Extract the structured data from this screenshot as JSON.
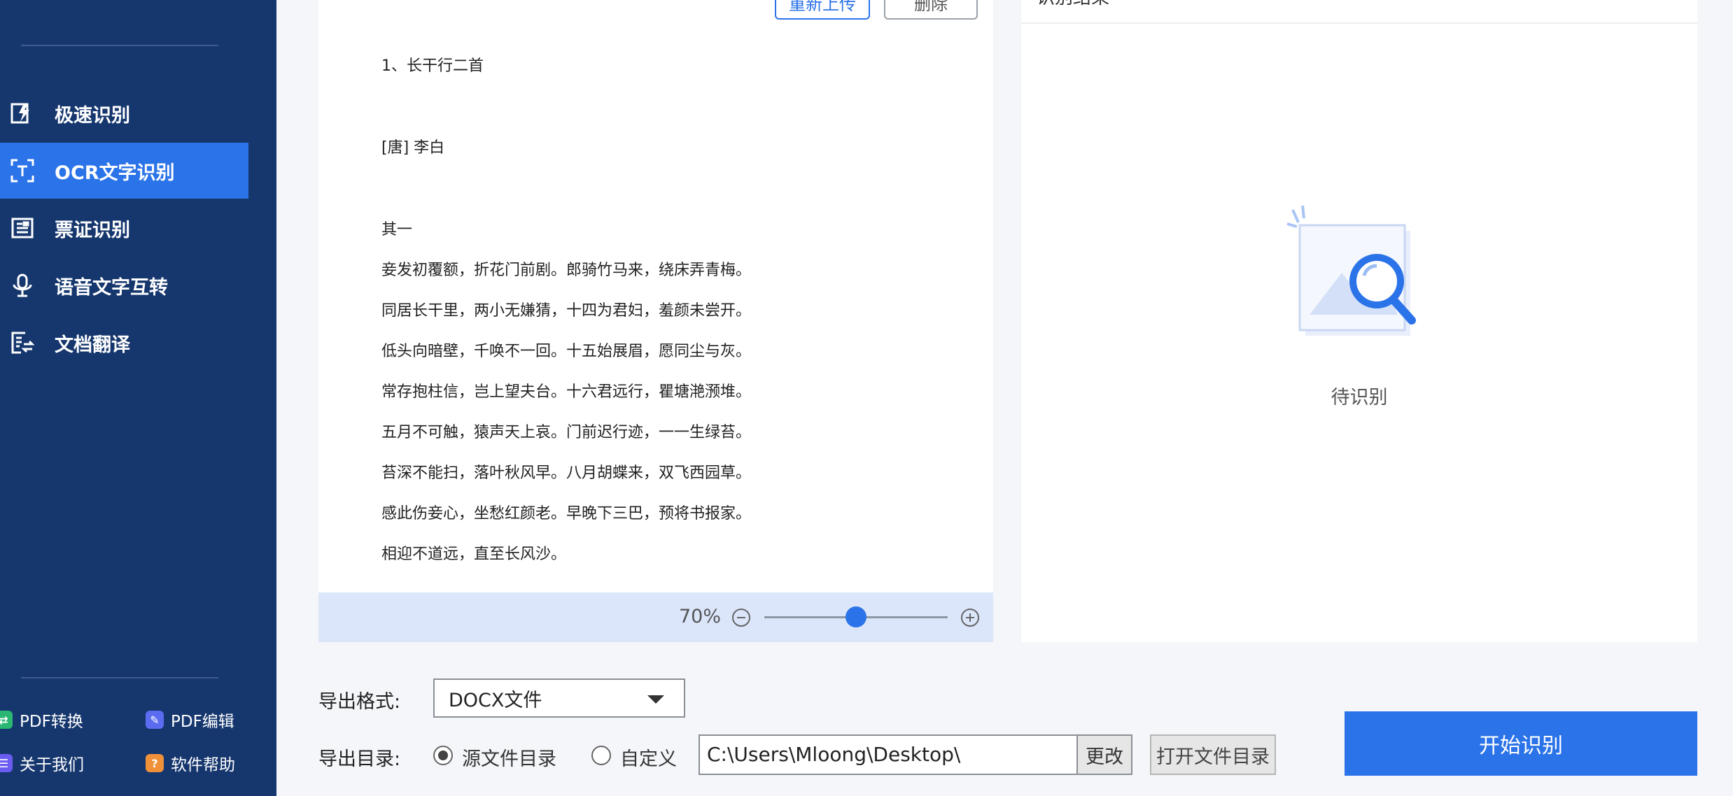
{
  "sidebar": {
    "nav": [
      {
        "label": "极速识别",
        "icon": "fast-recognition-icon"
      },
      {
        "label": "OCR文字识别",
        "icon": "ocr-icon",
        "active": true
      },
      {
        "label": "票证识别",
        "icon": "ticket-icon"
      },
      {
        "label": "语音文字互转",
        "icon": "microphone-icon"
      },
      {
        "label": "文档翻译",
        "icon": "document-translate-icon"
      }
    ],
    "footer": [
      {
        "label": "PDF转换",
        "icon": "pdf-convert-icon",
        "color": "#2bb673"
      },
      {
        "label": "PDF编辑",
        "icon": "pdf-edit-icon",
        "color": "#5b6cf0"
      },
      {
        "label": "关于我们",
        "icon": "about-icon",
        "color": "#6a5cf0"
      },
      {
        "label": "软件帮助",
        "icon": "help-icon",
        "color": "#f0913a"
      }
    ]
  },
  "preview": {
    "reupload_label": "重新上传",
    "delete_label": "删除",
    "lines": [
      "1、长干行二首",
      "[唐] 李白",
      "其一",
      "妾发初覆额，折花门前剧。郎骑竹马来，绕床弄青梅。",
      "同居长干里，两小无嫌猜，十四为君妇，羞颜未尝开。",
      "低头向暗壁，千唤不一回。十五始展眉，愿同尘与灰。",
      "常存抱柱信，岂上望夫台。十六君远行，瞿塘滟滪堆。",
      "五月不可触，猿声天上哀。门前迟行迹，一一生绿苔。",
      "苔深不能扫，落叶秋风早。八月胡蝶来，双飞西园草。",
      "感此伤妾心，坐愁红颜老。早晚下三巴，预将书报家。",
      "相迎不道远，直至长风沙。"
    ],
    "zoom_label": "70%",
    "zoom_level": 0.5
  },
  "result": {
    "title": "识别结果",
    "empty_text": "待识别"
  },
  "export": {
    "format_label": "导出格式:",
    "format_value": "DOCX文件",
    "dir_label": "导出目录:",
    "radio_source": "源文件目录",
    "radio_custom": "自定义",
    "path_value": "C:\\Users\\Mloong\\Desktop\\",
    "change_label": "更改",
    "open_dir_label": "打开文件目录",
    "start_label": "开始识别"
  },
  "colors": {
    "sidebar": "#16376e",
    "accent": "#2b73e8"
  }
}
